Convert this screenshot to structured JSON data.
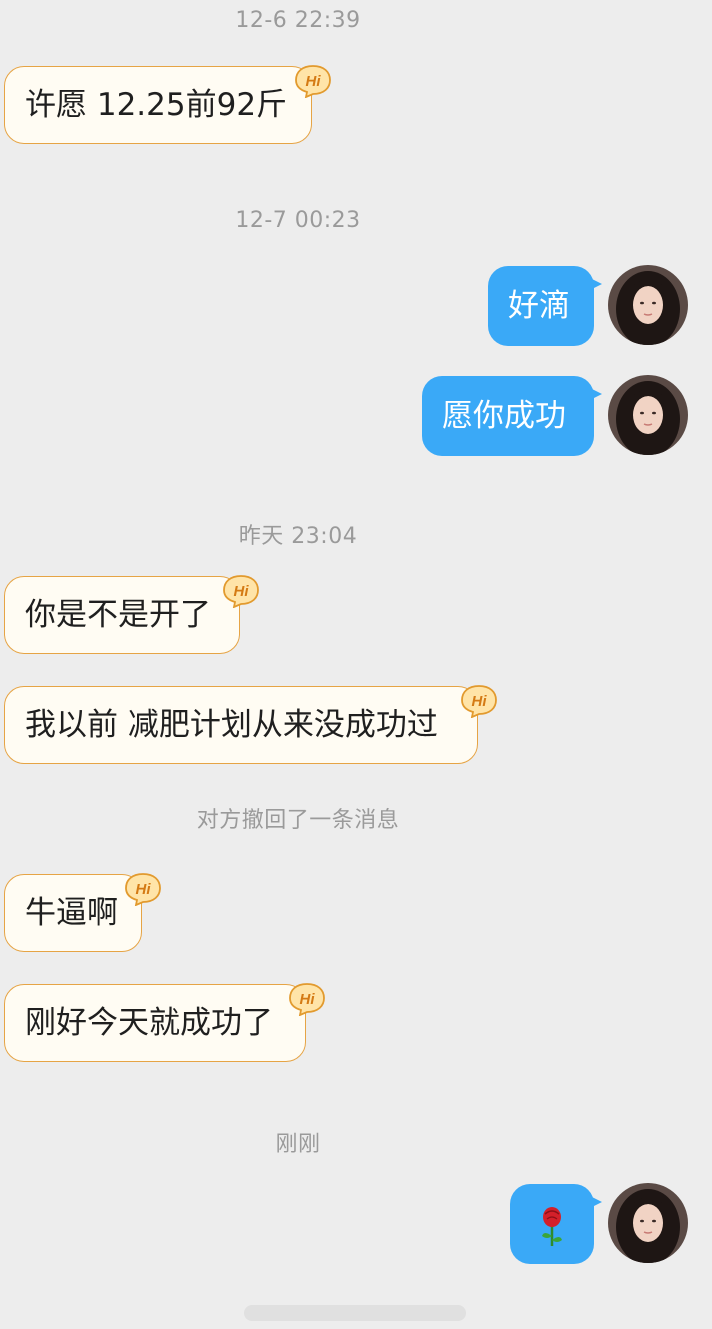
{
  "messages": {
    "ts1": "12-6 22:39",
    "m1": "许愿 12.25前92斤",
    "ts2": "12-7 00:23",
    "m2": "好滴",
    "m3": "愿你成功",
    "ts3": "昨天 23:04",
    "m4": "你是不是开了",
    "m5": "我以前 减肥计划从来没成功过",
    "recall": "对方撤回了一条消息",
    "m6": "牛逼啊",
    "m7": "刚好今天就成功了",
    "ts4": "刚刚",
    "m8": "🌹"
  },
  "badge_text": "Hi",
  "colors": {
    "background": "#ededed",
    "incoming_bubble": "#fffcf3",
    "incoming_border": "#e6a445",
    "outgoing_bubble": "#3aa9f7",
    "timestamp": "#9a9a9a"
  },
  "icons": [
    "hi-badge-icon",
    "rose-emoji-icon",
    "user-avatar"
  ]
}
